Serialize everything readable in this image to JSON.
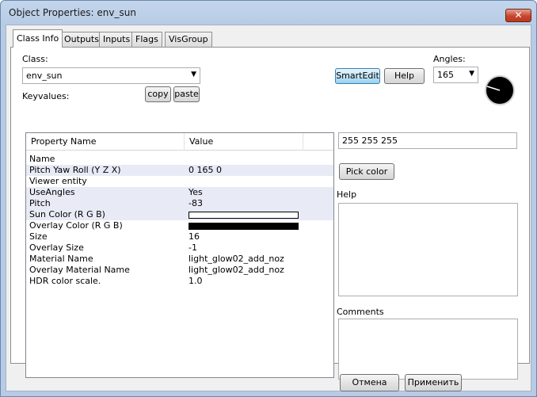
{
  "window": {
    "title": "Object Properties: env_sun",
    "close_glyph": "✕"
  },
  "tabs": [
    {
      "label": "Class Info",
      "active": true
    },
    {
      "label": "Outputs",
      "active": false
    },
    {
      "label": "Inputs",
      "active": false
    },
    {
      "label": "Flags",
      "active": false
    },
    {
      "label": "VisGroup",
      "active": false
    }
  ],
  "class_section": {
    "label": "Class:",
    "value": "env_sun",
    "keyvalues_label": "Keyvalues:",
    "copy_label": "copy",
    "paste_label": "paste",
    "smartedit_label": "SmartEdit",
    "help_label": "Help"
  },
  "angles": {
    "label": "Angles:",
    "value": "165",
    "dial_icon": "angle-dial-icon"
  },
  "table": {
    "columns": [
      "Property Name",
      "Value"
    ],
    "rows": [
      {
        "name": "Name",
        "value": "",
        "selected": false
      },
      {
        "name": "Pitch Yaw Roll (Y Z X)",
        "value": "0 165 0",
        "selected": true
      },
      {
        "name": "Viewer entity",
        "value": "",
        "selected": false
      },
      {
        "name": "UseAngles",
        "value": "Yes",
        "selected": true
      },
      {
        "name": "Pitch",
        "value": "-83",
        "selected": true
      },
      {
        "name": "Sun Color (R G B)",
        "value": "",
        "color": "#ffffff",
        "selected": true
      },
      {
        "name": "Overlay Color (R G B)",
        "value": "",
        "color": "#000000",
        "selected": false
      },
      {
        "name": "Size",
        "value": "16",
        "selected": false
      },
      {
        "name": "Overlay Size",
        "value": "-1",
        "selected": false
      },
      {
        "name": "Material Name",
        "value": "light_glow02_add_noz",
        "selected": false
      },
      {
        "name": "Overlay Material Name",
        "value": "light_glow02_add_noz",
        "selected": false
      },
      {
        "name": "HDR color scale.",
        "value": "1.0",
        "selected": false
      }
    ]
  },
  "right_panel": {
    "value_field": "255 255 255",
    "pick_color_label": "Pick color",
    "help_label": "Help",
    "comments_label": "Comments"
  },
  "footer": {
    "cancel_label": "Отмена",
    "apply_label": "Применить"
  },
  "colors": {
    "title_bar": "#b7cbe6",
    "close_red": "#c9452e",
    "selection": "#e8eaf5"
  }
}
